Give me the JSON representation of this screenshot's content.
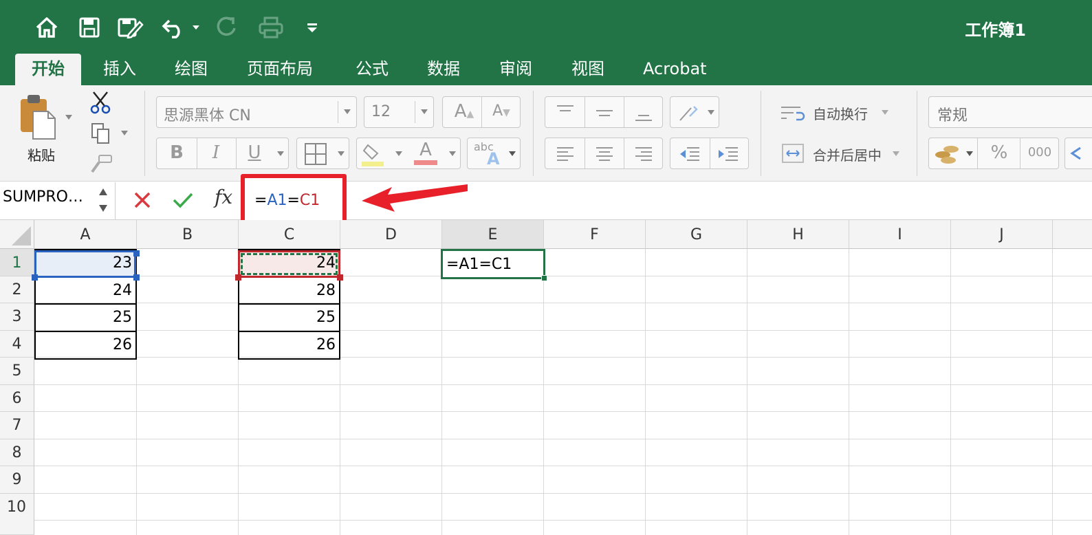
{
  "window": {
    "title": "工作簿1"
  },
  "quick_access": [
    {
      "icon": "home-icon"
    },
    {
      "icon": "save-icon"
    },
    {
      "icon": "edit-icon"
    },
    {
      "icon": "undo-icon"
    },
    {
      "icon": "redo-icon"
    },
    {
      "icon": "print-icon"
    },
    {
      "icon": "customize-icon"
    }
  ],
  "tabs": [
    "开始",
    "插入",
    "绘图",
    "页面布局",
    "公式",
    "数据",
    "审阅",
    "视图",
    "Acrobat"
  ],
  "active_tab": "开始",
  "ribbon": {
    "paste_label": "粘贴",
    "font_name": "思源黑体 CN",
    "font_size": "12",
    "bold": "B",
    "italic": "I",
    "underline": "U",
    "font_color_glyph": "A",
    "abc": "abc",
    "wrap_text": "自动换行",
    "merge_center": "合并后居中",
    "number_format": "常规",
    "percent": "%",
    "thousands": "000"
  },
  "formula_bar": {
    "name_box": "SUMPRO…",
    "fx": "fx",
    "formula_parts": [
      {
        "text": "=",
        "color": "#000000"
      },
      {
        "text": "A1",
        "color": "#2a62c0"
      },
      {
        "text": "=",
        "color": "#000000"
      },
      {
        "text": "C1",
        "color": "#c0282d"
      }
    ]
  },
  "sheet": {
    "columns": [
      "A",
      "B",
      "C",
      "D",
      "E",
      "F",
      "G",
      "H",
      "I",
      "J"
    ],
    "rows": [
      "1",
      "2",
      "3",
      "4",
      "5",
      "6",
      "7",
      "8",
      "9",
      "10"
    ],
    "cells": {
      "A1": "23",
      "A2": "24",
      "A3": "25",
      "A4": "26",
      "C1": "24",
      "C2": "28",
      "C3": "25",
      "C4": "26",
      "E1": "=A1=C1"
    },
    "active_cell": "E1"
  },
  "colors": {
    "accent": "#227447",
    "ref_blue": "#2a62c0",
    "ref_red": "#c0282d",
    "annotation": "#e8202a"
  }
}
